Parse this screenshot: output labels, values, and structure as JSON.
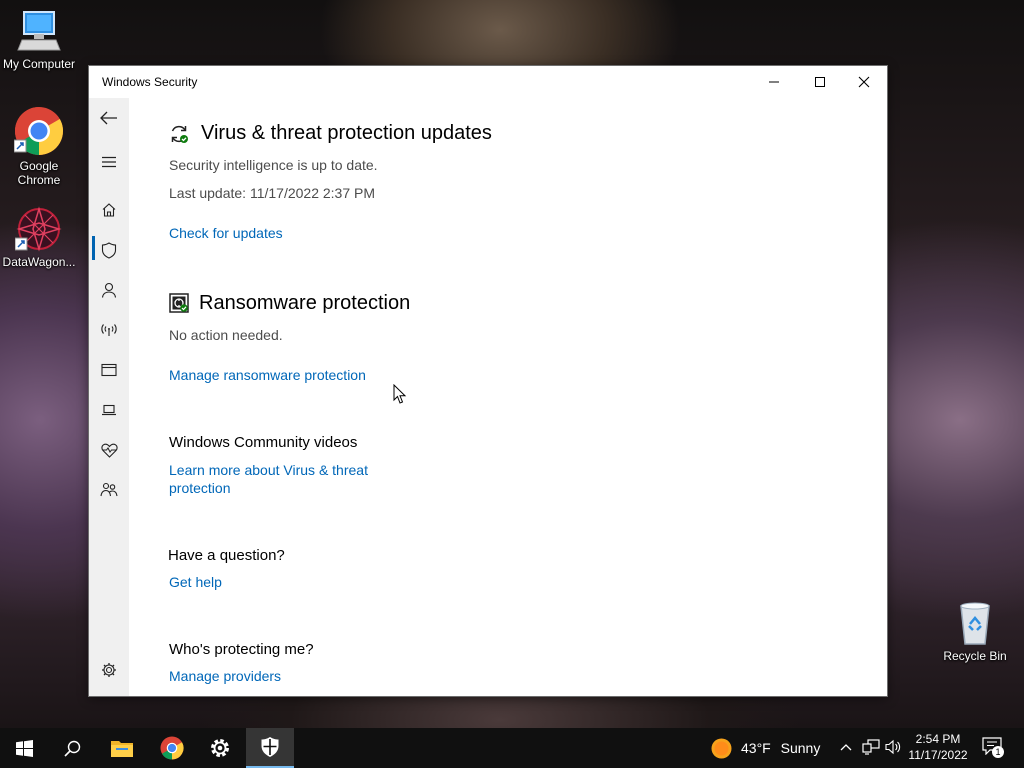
{
  "desktop": {
    "icons": [
      {
        "label": "My Computer",
        "icon": "computer-icon"
      },
      {
        "label": "Google Chrome",
        "icon": "chrome-icon"
      },
      {
        "label": "DataWagon...",
        "icon": "datawagon-icon"
      },
      {
        "label": "Recycle Bin",
        "icon": "recycle-bin-icon"
      }
    ]
  },
  "window": {
    "title": "Windows Security",
    "controls": {
      "minimize": "minimize-icon",
      "maximize": "maximize-icon",
      "close": "close-icon"
    }
  },
  "nav": {
    "items": [
      {
        "name": "back",
        "icon": "back-arrow-icon"
      },
      {
        "name": "menu",
        "icon": "hamburger-icon"
      },
      {
        "name": "home",
        "icon": "home-icon"
      },
      {
        "name": "virus-protection",
        "icon": "shield-icon",
        "active": true
      },
      {
        "name": "account-protection",
        "icon": "person-icon"
      },
      {
        "name": "firewall",
        "icon": "wireless-icon"
      },
      {
        "name": "app-browser-control",
        "icon": "browser-window-icon"
      },
      {
        "name": "device-security",
        "icon": "laptop-icon"
      },
      {
        "name": "device-performance",
        "icon": "heart-pulse-icon"
      },
      {
        "name": "family-options",
        "icon": "family-icon"
      },
      {
        "name": "settings",
        "icon": "gear-icon"
      }
    ]
  },
  "updates": {
    "title": "Virus & threat protection updates",
    "status": "Security intelligence is up to date.",
    "last_update": "Last update: 11/17/2022 2:37 PM",
    "link": "Check for updates"
  },
  "ransomware": {
    "title": "Ransomware protection",
    "status": "No action needed.",
    "link": "Manage ransomware protection"
  },
  "community": {
    "title": "Windows Community videos",
    "link": "Learn more about Virus & threat protection"
  },
  "question": {
    "title": "Have a question?",
    "link": "Get help"
  },
  "protecting": {
    "title": "Who's protecting me?",
    "link": "Manage providers"
  },
  "taskbar": {
    "apps": [
      {
        "name": "start",
        "icon": "windows-start-icon"
      },
      {
        "name": "search",
        "icon": "search-icon"
      },
      {
        "name": "file-explorer",
        "icon": "folder-icon"
      },
      {
        "name": "chrome",
        "icon": "chrome-icon"
      },
      {
        "name": "settings",
        "icon": "gear-icon"
      },
      {
        "name": "windows-security",
        "icon": "shield-icon",
        "active": true
      }
    ],
    "weather": {
      "temp": "43°F",
      "condition": "Sunny"
    },
    "time": "2:54 PM",
    "date": "11/17/2022",
    "notification_count": "1"
  },
  "colors": {
    "link": "#0067b8",
    "accent": "#0063b1",
    "nav_bg": "#f0f0f0",
    "taskbar_bg": "#101010"
  }
}
